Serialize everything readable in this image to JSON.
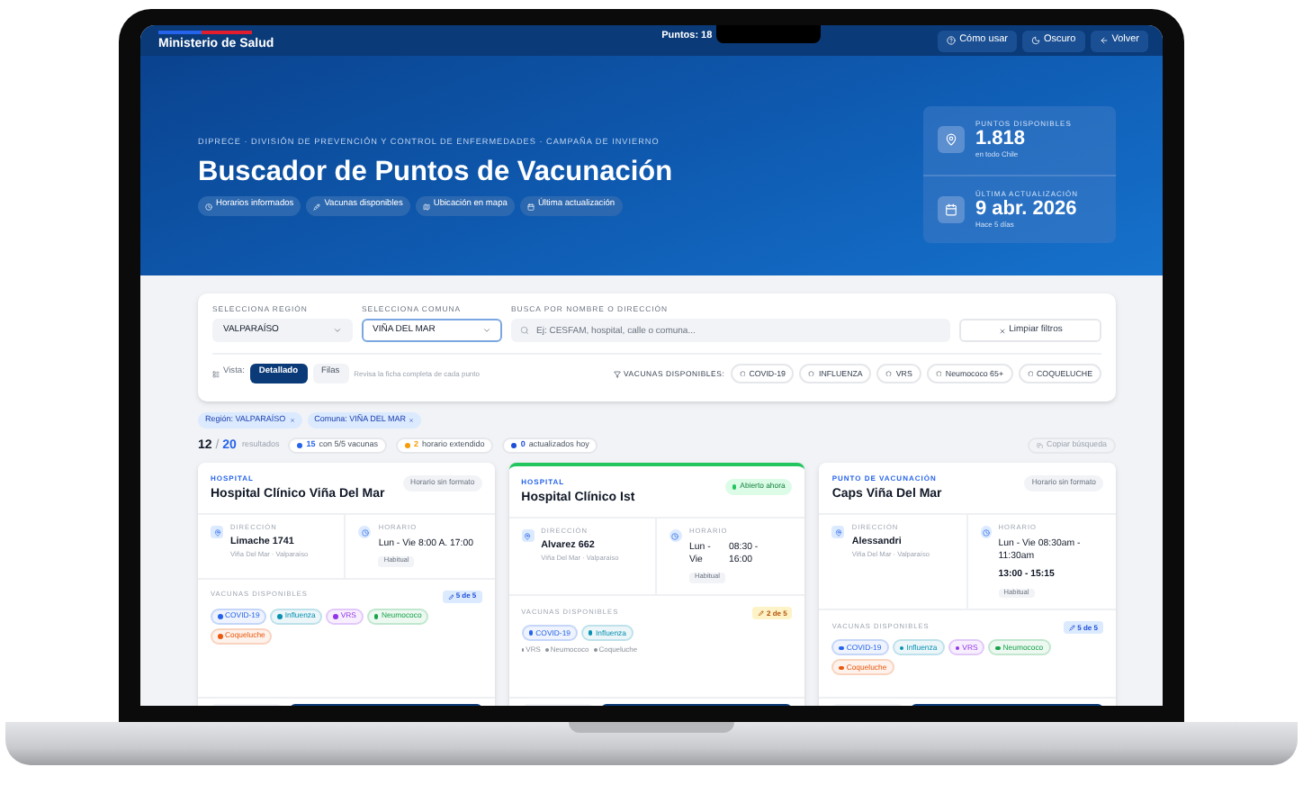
{
  "header": {
    "logo": "Ministerio de Salud",
    "points_label": "Puntos: 18",
    "buttons": [
      {
        "label": "Cómo usar",
        "kind": "help"
      },
      {
        "label": "Oscuro",
        "kind": "theme"
      },
      {
        "label": "Volver",
        "kind": "back"
      }
    ]
  },
  "hero": {
    "breadcrumb": "DIPRECE · DIVISIÓN DE PREVENCIÓN Y CONTROL DE ENFERMEDADES · CAMPAÑA DE INVIERNO",
    "title": "Buscador de Puntos de Vacunación",
    "chips": [
      {
        "label": "Horarios informados",
        "kind": "clock"
      },
      {
        "label": "Vacunas disponibles",
        "kind": "syringe"
      },
      {
        "label": "Ubicación en mapa",
        "kind": "map"
      },
      {
        "label": "Última actualización",
        "kind": "calendar"
      }
    ],
    "stats": [
      {
        "label": "PUNTOS DISPONIBLES",
        "value": "1.818",
        "sub": "en todo Chile",
        "kind": "pin"
      },
      {
        "label": "ÚLTIMA ACTUALIZACIÓN",
        "value": "9 abr. 2026",
        "sub": "Hace 5 días",
        "kind": "calendar"
      }
    ]
  },
  "filters": {
    "fields": [
      {
        "label": "SELECCIONA REGIÓN",
        "kind": "select",
        "value": "VALPARAÍSO",
        "focused": false
      },
      {
        "label": "SELECCIONA COMUNA",
        "kind": "select",
        "value": "VIÑA DEL MAR",
        "focused": true
      },
      {
        "label": "BUSCA POR NOMBRE O DIRECCIÓN",
        "kind": "search",
        "placeholder": "Ej: CESFAM, hospital, calle o comuna..."
      }
    ],
    "clear_button": "Limpiar filtros",
    "view_label": "Vista:",
    "view_options": [
      {
        "label": "Detallado",
        "selected": true
      },
      {
        "label": "Filas",
        "selected": false
      }
    ],
    "view_hint": "Revisa la ficha completa de cada punto",
    "vaccines_label": "VACUNAS DISPONIBLES:",
    "vaccine_filters": [
      "COVID-19",
      "INFLUENZA",
      "VRS",
      "Neumococo 65+",
      "COQUELUCHE"
    ]
  },
  "active_filters": [
    "Región: VALPARAÍSO",
    "Comuna: VIÑA DEL MAR"
  ],
  "results": {
    "shown": "12",
    "separator": "/",
    "total": "20",
    "label": "resultados",
    "stats": [
      {
        "count": "15",
        "text": "con 5/5 vacunas",
        "color": "#2563eb"
      },
      {
        "count": "2",
        "text": "horario extendido",
        "color": "#f59e0b"
      },
      {
        "count": "0",
        "text": "actualizados hoy",
        "color": "#1d4ed8"
      }
    ],
    "copy_button": "Copiar búsqueda"
  },
  "cards": [
    {
      "type": "HOSPITAL",
      "name": "Hospital Clínico Viña Del Mar",
      "status": {
        "label": "Horario sin formato",
        "kind": "neutral"
      },
      "address_label": "DIRECCIÓN",
      "address": "Limache 1741",
      "locality": "Viña Del Mar · Valparaíso",
      "schedule_label": "HORARIO",
      "schedule": [
        {
          "kind": "line",
          "text": "Lun - Vie 8:00 A. 17:00"
        }
      ],
      "schedule_tag": "Habitual",
      "vaccines_label": "VACUNAS DISPONIBLES",
      "coverage": {
        "label": "5 de 5",
        "kind": "full"
      },
      "vaccines": [
        {
          "name": "COVID-19",
          "available": true,
          "color": "#2563eb"
        },
        {
          "name": "Influenza",
          "available": true,
          "color": "#0891b2"
        },
        {
          "name": "VRS",
          "available": true,
          "color": "#9333ea"
        },
        {
          "name": "Neumococo",
          "available": true,
          "color": "#16a34a"
        },
        {
          "name": "Coqueluche",
          "available": true,
          "color": "#ea580c"
        }
      ]
    },
    {
      "type": "HOSPITAL",
      "name": "Hospital Clínico Ist",
      "status": {
        "label": "Abierto ahora",
        "kind": "open"
      },
      "address_label": "DIRECCIÓN",
      "address": "Alvarez 662",
      "locality": "Viña Del Mar · Valparaíso",
      "schedule_label": "HORARIO",
      "schedule": [
        {
          "kind": "split",
          "day": "Lun - Vie",
          "hours": "08:30 - 16:00"
        }
      ],
      "schedule_tag": "Habitual",
      "vaccines_label": "VACUNAS DISPONIBLES",
      "coverage": {
        "label": "2 de 5",
        "kind": "partial"
      },
      "vaccines": [
        {
          "name": "COVID-19",
          "available": true,
          "color": "#2563eb"
        },
        {
          "name": "Influenza",
          "available": true,
          "color": "#0891b2"
        },
        {
          "name": "VRS",
          "available": false
        },
        {
          "name": "Neumococo",
          "available": false
        },
        {
          "name": "Coqueluche",
          "available": false
        }
      ]
    },
    {
      "type": "PUNTO DE VACUNACIÓN",
      "name": "Caps Viña Del Mar",
      "status": {
        "label": "Horario sin formato",
        "kind": "neutral"
      },
      "address_label": "DIRECCIÓN",
      "address": "Alessandri",
      "locality": "Viña Del Mar · Valparaíso",
      "schedule_label": "HORARIO",
      "schedule": [
        {
          "kind": "line",
          "text": "Lun - Vie 08:30am - 11:30am"
        },
        {
          "kind": "line",
          "text": "13:00 - 15:15"
        }
      ],
      "schedule_tag": "Habitual",
      "vaccines_label": "VACUNAS DISPONIBLES",
      "coverage": {
        "label": "5 de 5",
        "kind": "full"
      },
      "vaccines": [
        {
          "name": "COVID-19",
          "available": true,
          "color": "#2563eb"
        },
        {
          "name": "Influenza",
          "available": true,
          "color": "#0891b2"
        },
        {
          "name": "VRS",
          "available": true,
          "color": "#9333ea"
        },
        {
          "name": "Neumococo",
          "available": true,
          "color": "#16a34a"
        },
        {
          "name": "Coqueluche",
          "available": true,
          "color": "#ea580c"
        }
      ]
    }
  ]
}
